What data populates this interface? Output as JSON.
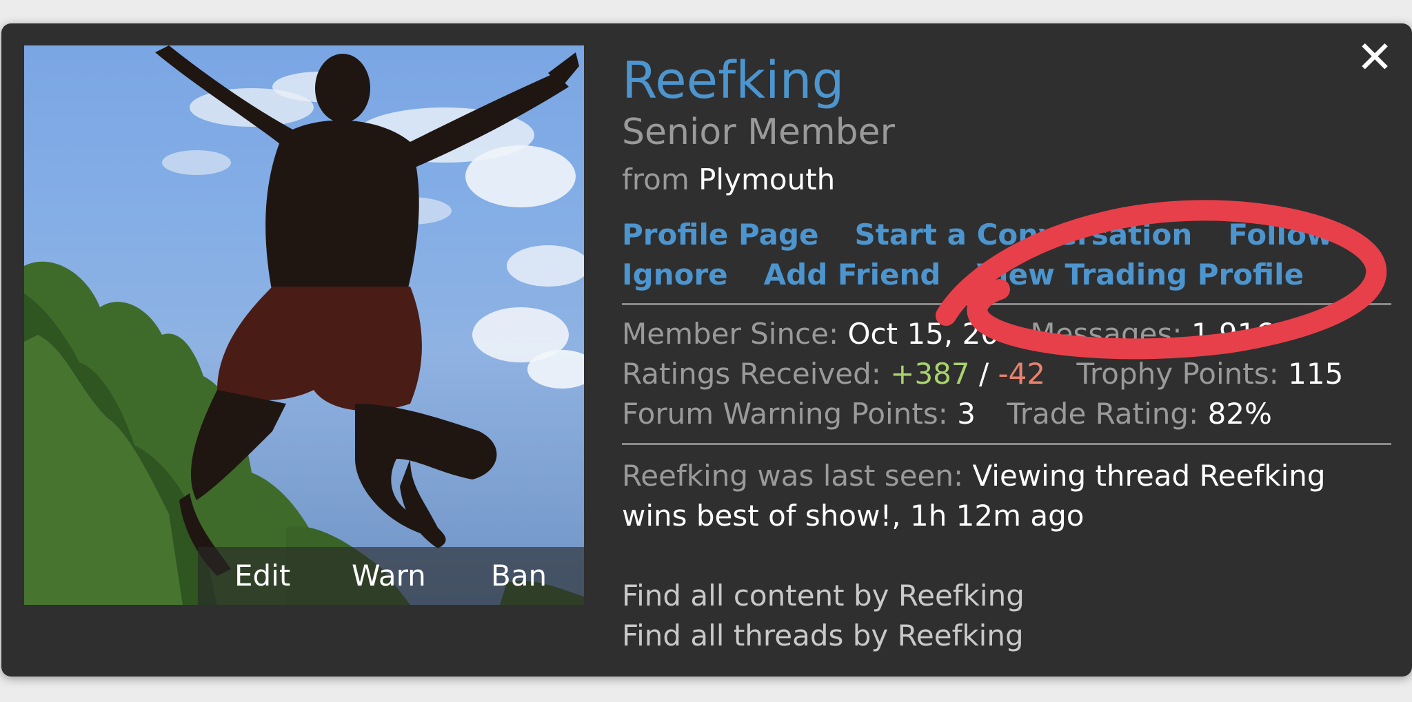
{
  "profile": {
    "username": "Reefking",
    "title": "Senior Member",
    "from_label": "from",
    "location": "Plymouth"
  },
  "actions": {
    "profile_page": "Profile Page",
    "start_conversation": "Start a Conversation",
    "follow": "Follow",
    "ignore": "Ignore",
    "add_friend": "Add Friend",
    "view_trading_profile": "View Trading Profile"
  },
  "moderation": {
    "edit": "Edit",
    "warn": "Warn",
    "ban": "Ban"
  },
  "stats": {
    "member_since_label": "Member Since:",
    "member_since_value": "Oct 15, 20",
    "messages_label": "Messages:",
    "messages_value": "1,916",
    "ratings_label": "Ratings Received:",
    "ratings_positive": "+387",
    "ratings_sep": "/",
    "ratings_negative": "-42",
    "trophy_label": "Trophy Points:",
    "trophy_value": "115",
    "warning_label": "Forum Warning Points:",
    "warning_value": "3",
    "trade_label": "Trade Rating:",
    "trade_value": "82%"
  },
  "last_seen": {
    "label": "Reefking was last seen:",
    "value": "Viewing thread Reefking wins best of show!, 1h 12m ago"
  },
  "find": {
    "content": "Find all content by Reefking",
    "threads": "Find all threads by Reefking"
  },
  "close_icon": "close-icon",
  "colors": {
    "card_bg": "#2f2f2f",
    "link": "#4c95cf",
    "muted": "#9a9a9a",
    "positive": "#a8d36b",
    "negative": "#e8826e",
    "annotation": "#e8404a"
  }
}
